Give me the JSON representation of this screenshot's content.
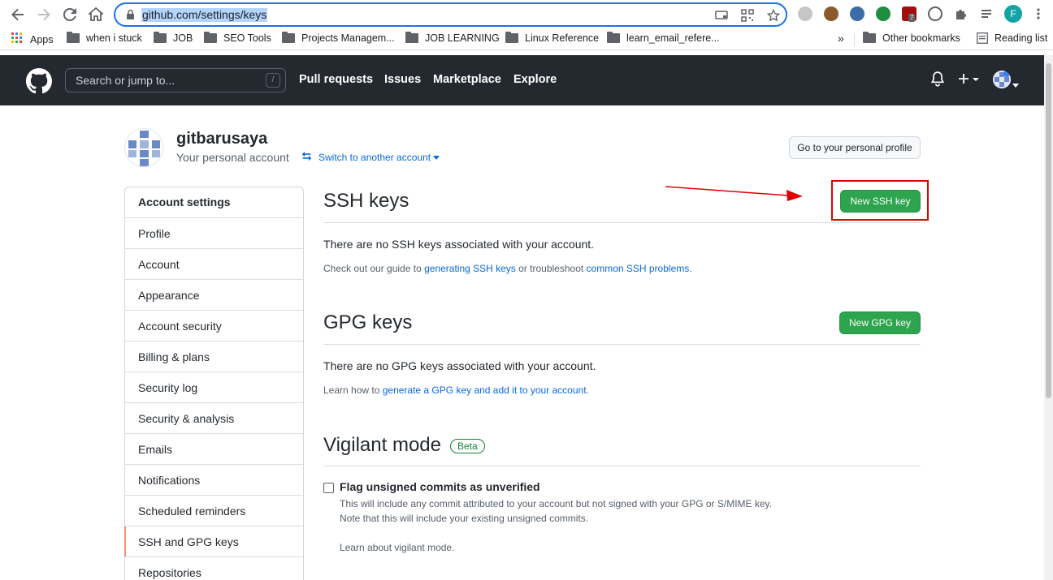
{
  "browser": {
    "url": "github.com/settings/keys",
    "profile_initial": "F",
    "bookmarks": [
      {
        "label": "Apps"
      },
      {
        "label": "when i stuck"
      },
      {
        "label": "JOB"
      },
      {
        "label": "SEO Tools"
      },
      {
        "label": "Projects Managem..."
      },
      {
        "label": "JOB LEARNING"
      },
      {
        "label": "Linux Reference"
      },
      {
        "label": "learn_email_refere..."
      }
    ],
    "overflow_label": "»",
    "other_bookmarks": "Other bookmarks",
    "reading_list": "Reading list",
    "extension_badge": "7"
  },
  "header": {
    "search_placeholder": "Search or jump to...",
    "search_shortcut": "/",
    "nav": [
      "Pull requests",
      "Issues",
      "Marketplace",
      "Explore"
    ]
  },
  "account": {
    "username": "gitbarusaya",
    "subtitle": "Your personal account",
    "switch_label": "Switch to another account",
    "profile_button": "Go to your personal profile"
  },
  "sidebar": {
    "heading": "Account settings",
    "items": [
      {
        "label": "Profile"
      },
      {
        "label": "Account"
      },
      {
        "label": "Appearance"
      },
      {
        "label": "Account security"
      },
      {
        "label": "Billing & plans"
      },
      {
        "label": "Security log"
      },
      {
        "label": "Security & analysis"
      },
      {
        "label": "Emails"
      },
      {
        "label": "Notifications"
      },
      {
        "label": "Scheduled reminders"
      },
      {
        "label": "SSH and GPG keys"
      },
      {
        "label": "Repositories"
      }
    ],
    "active": "SSH and GPG keys"
  },
  "ssh": {
    "title": "SSH keys",
    "button": "New SSH key",
    "empty_text": "There are no SSH keys associated with your account.",
    "note_prefix": "Check out our guide to ",
    "note_link1": "generating SSH keys",
    "note_middle": " or troubleshoot ",
    "note_link2": "common SSH problems",
    "note_suffix": "."
  },
  "gpg": {
    "title": "GPG keys",
    "button": "New GPG key",
    "empty_text": "There are no GPG keys associated with your account.",
    "note_prefix": "Learn how to ",
    "note_link": "generate a GPG key and add it to your account",
    "note_suffix": "."
  },
  "vigilant": {
    "title": "Vigilant mode",
    "badge": "Beta",
    "checkbox_label": "Flag unsigned commits as unverified",
    "checked": false,
    "note_line1": "This will include any commit attributed to your account but not signed with your GPG or S/MIME key.",
    "note_line2": "Note that this will include your existing unsigned commits.",
    "learn_link": "Learn about vigilant mode."
  },
  "colors": {
    "github_dark": "#24292f",
    "primary_green": "#2da44e",
    "link_blue": "#0969da",
    "annotation_red": "#e00000"
  }
}
